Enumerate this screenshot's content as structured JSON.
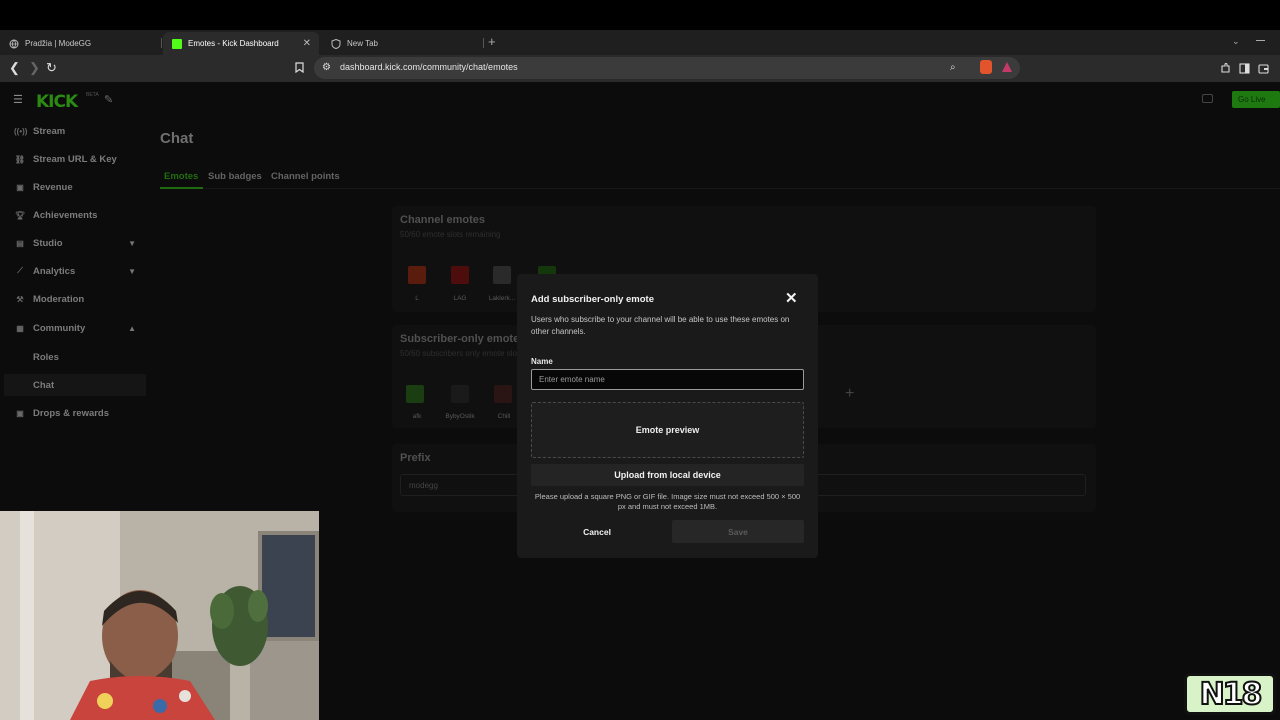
{
  "browser": {
    "tabs": [
      {
        "title": "Pradžia | ModeGG"
      },
      {
        "title": "Emotes - Kick Dashboard"
      },
      {
        "title": "New Tab"
      }
    ],
    "new_tab_symbol": "+",
    "url": "dashboard.kick.com/community/chat/emotes"
  },
  "header": {
    "logo": "KICK",
    "logo_badge": "BETA",
    "go_live_label": "Go Live"
  },
  "sidebar": {
    "items": [
      {
        "label": "Stream",
        "icon": "broadcast-icon"
      },
      {
        "label": "Stream URL & Key",
        "icon": "link-icon"
      },
      {
        "label": "Revenue",
        "icon": "revenue-icon"
      },
      {
        "label": "Achievements",
        "icon": "trophy-icon"
      },
      {
        "label": "Studio",
        "icon": "studio-icon"
      },
      {
        "label": "Analytics",
        "icon": "analytics-icon"
      },
      {
        "label": "Moderation",
        "icon": "hammer-icon"
      },
      {
        "label": "Community",
        "icon": "community-icon"
      },
      {
        "label": "Drops & rewards",
        "icon": "gift-icon"
      }
    ],
    "community_subitems": [
      "Roles",
      "Chat"
    ]
  },
  "main": {
    "title": "Chat",
    "tabs": [
      "Emotes",
      "Sub badges",
      "Channel points"
    ],
    "channel_emotes": {
      "title": "Channel emotes",
      "subtitle": "50/60 emote slots remaining",
      "emotes": [
        "L",
        "LAG",
        "Laklerk..."
      ]
    },
    "subscriber_emotes": {
      "title": "Subscriber-only emotes",
      "subtitle": "50/60 subscribers only emote slots remaining",
      "emotes": [
        "afk",
        "BybyOstik",
        "Chill"
      ]
    },
    "prefix": {
      "title": "Prefix",
      "value": "modegg"
    }
  },
  "modal": {
    "title": "Add subscriber-only emote",
    "description": "Users who subscribe to your channel will be able to use these emotes on other channels.",
    "name_label": "Name",
    "name_placeholder": "Enter emote name",
    "preview_label": "Emote preview",
    "upload_label": "Upload from local device",
    "help_text": "Please upload a square PNG or GIF file. Image size must not exceed 500 × 500 px and must not exceed 1MB.",
    "cancel_label": "Cancel",
    "save_label": "Save"
  },
  "overlay": {
    "watermark": "N18"
  },
  "colors": {
    "kick_green": "#53fc18",
    "modal_bg": "#191a19"
  }
}
